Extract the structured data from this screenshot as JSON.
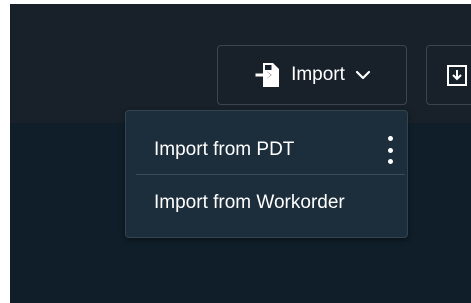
{
  "toolbar": {
    "import_label": "Import",
    "import_icon": "file-import-icon",
    "import_chevron": "chevron-down-icon",
    "export_icon": "download-icon"
  },
  "import_menu": {
    "items": [
      {
        "label": "Import from PDT",
        "has_more_options": true,
        "more_icon": "kebab-menu-icon"
      },
      {
        "label": "Import from Workorder",
        "has_more_options": false
      }
    ]
  },
  "colors": {
    "header_bg": "#182129",
    "content_bg": "#0f1e29",
    "menu_bg": "#1c2d3b",
    "border": "#3a4550",
    "text": "#ffffff"
  }
}
